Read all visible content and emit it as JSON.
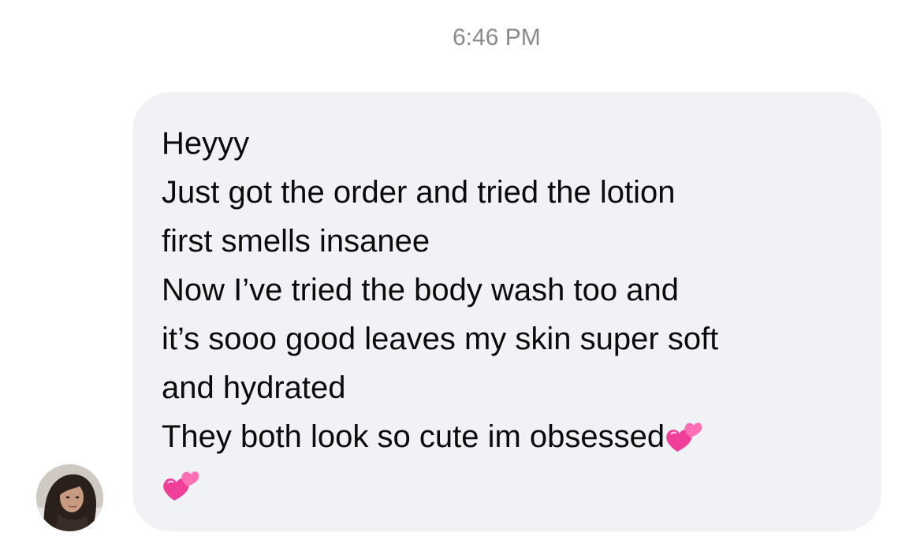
{
  "header": {
    "timestamp": "6:46 PM"
  },
  "message": {
    "sender_avatar": "avatar-photo",
    "lines": [
      "Heyyy",
      "Just got the order and tried the lotion",
      "first smells insanee",
      "Now I’ve tried the body wash too and",
      "it’s sooo good leaves my skin super soft",
      "and hydrated",
      "They both look so cute im obsessed"
    ],
    "emoji": [
      "two-hearts-emoji",
      "two-hearts-emoji"
    ]
  },
  "colors": {
    "bubble_bg": "#f1f2f6",
    "timestamp": "#8a8a8e",
    "heart_pink": "#f0449c"
  }
}
